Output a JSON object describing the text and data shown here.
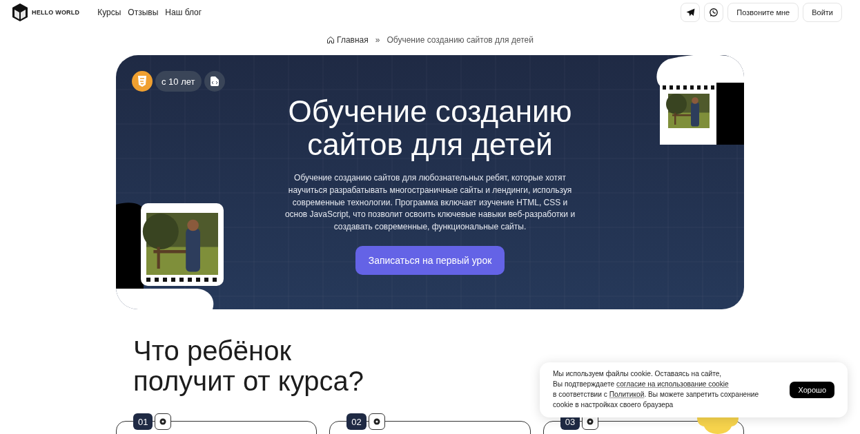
{
  "header": {
    "logo": "HELLO WORLD",
    "nav": [
      "Курсы",
      "Отзывы",
      "Наш блог"
    ],
    "buttons": [
      "Позвоните мне",
      "Войти"
    ]
  },
  "breadcrumb": {
    "home": "Главная",
    "separator": "»",
    "current": "Обучение созданию сайтов для детей"
  },
  "hero": {
    "age": "с 10 лет",
    "title": "Обучение созданию сайтов для детей",
    "description": "Обучение созданию сайтов для любознательных ребят, которые хотят научиться разрабатывать многостраничные сайты и лендинги, используя современные технологии. Программа включает изучение HTML, CSS и основ JavaScript, что позволит освоить ключевые навыки веб-разработки и создавать современные, функциональные сайты.",
    "cta": "Записаться на первый урок"
  },
  "benefits": {
    "title": "Что ребёнок получит от курса?",
    "cards": [
      {
        "number": "01"
      },
      {
        "number": "02"
      },
      {
        "number": "03"
      }
    ]
  },
  "cookie": {
    "parts": [
      {
        "kind": "text",
        "text": "Мы используем файлы cookie. Оставаясь на сайте,"
      },
      {
        "kind": "break"
      },
      {
        "kind": "text",
        "text": "Вы подтверждаете "
      },
      {
        "kind": "link",
        "text": "согласие на использование cookie"
      },
      {
        "kind": "break"
      },
      {
        "kind": "text",
        "text": "в соответствии с "
      },
      {
        "kind": "link",
        "text": "Политикой"
      },
      {
        "kind": "text",
        "text": ". Вы можете запретить сохранение"
      },
      {
        "kind": "break"
      },
      {
        "kind": "text",
        "text": "cookie в настройках своего браузера"
      }
    ],
    "button": "Хорошо"
  }
}
